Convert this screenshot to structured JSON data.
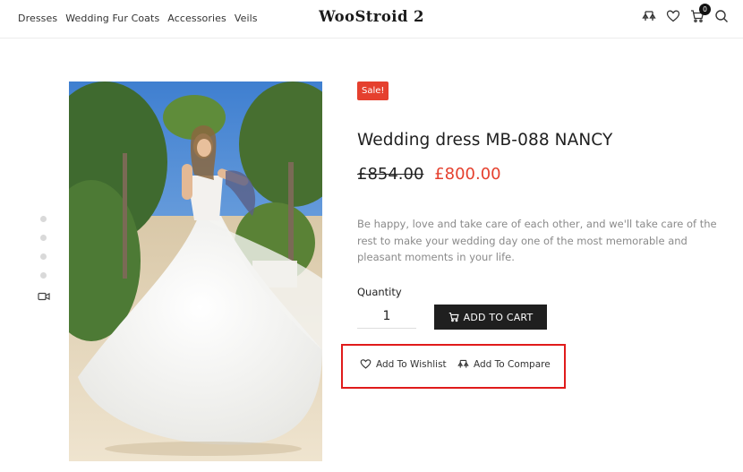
{
  "nav": {
    "items": [
      "Dresses",
      "Wedding Fur Coats",
      "Accessories",
      "Veils"
    ]
  },
  "logo": "WooStroid 2",
  "header_icons": [
    "compare-icon",
    "heart-icon",
    "cart-icon",
    "search-icon"
  ],
  "cart_count": "0",
  "gallery": {
    "dots": 4,
    "video_icon": "video-icon"
  },
  "product": {
    "badge": "Sale!",
    "title": "Wedding dress MB-088 NANCY",
    "old_price": "£854.00",
    "new_price": "£800.00",
    "description": "Be happy, love and take care of each other, and we'll take care of the rest to make your wedding day one of the most memorable and pleasant moments in your life.",
    "quantity_label": "Quantity",
    "quantity_value": "1",
    "add_to_cart": "ADD TO CART",
    "wishlist": "Add To Wishlist",
    "compare": "Add To Compare"
  },
  "colors": {
    "sale_red": "#e5402e",
    "button_dark": "#1f1f1f",
    "highlight_red": "#e01b1b"
  }
}
